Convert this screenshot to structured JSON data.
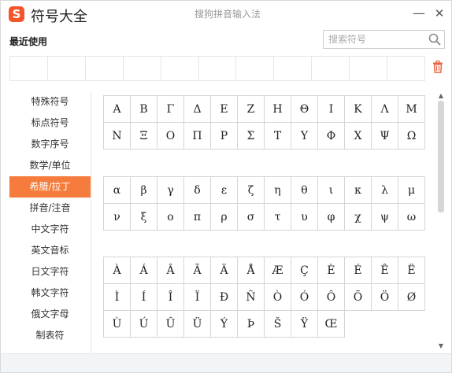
{
  "app": {
    "logo_letter": "S",
    "title": "符号大全",
    "ime_name": "搜狗拼音输入法",
    "minimize_glyph": "—",
    "close_glyph": "✕"
  },
  "recent": {
    "label": "最近使用",
    "slots": 11
  },
  "search": {
    "placeholder": "搜索符号",
    "value": ""
  },
  "sidebar": {
    "items": [
      {
        "label": "特殊符号",
        "active": false
      },
      {
        "label": "标点符号",
        "active": false
      },
      {
        "label": "数字序号",
        "active": false
      },
      {
        "label": "数学/单位",
        "active": false
      },
      {
        "label": "希腊/拉丁",
        "active": true
      },
      {
        "label": "拼音/注音",
        "active": false
      },
      {
        "label": "中文字符",
        "active": false
      },
      {
        "label": "英文音标",
        "active": false
      },
      {
        "label": "日文字符",
        "active": false
      },
      {
        "label": "韩文字符",
        "active": false
      },
      {
        "label": "俄文字母",
        "active": false
      },
      {
        "label": "制表符",
        "active": false
      }
    ]
  },
  "symbol_groups": [
    {
      "id": "greek-upper",
      "symbols": [
        "Α",
        "Β",
        "Γ",
        "Δ",
        "Ε",
        "Ζ",
        "Η",
        "Θ",
        "Ι",
        "Κ",
        "Λ",
        "Μ",
        "Ν",
        "Ξ",
        "Ο",
        "Π",
        "Ρ",
        "Σ",
        "Τ",
        "Υ",
        "Φ",
        "Χ",
        "Ψ",
        "Ω"
      ]
    },
    {
      "id": "greek-lower",
      "symbols": [
        "α",
        "β",
        "γ",
        "δ",
        "ε",
        "ζ",
        "η",
        "θ",
        "ι",
        "κ",
        "λ",
        "μ",
        "ν",
        "ξ",
        "ο",
        "π",
        "ρ",
        "σ",
        "τ",
        "υ",
        "φ",
        "χ",
        "ψ",
        "ω"
      ]
    },
    {
      "id": "latin-extended",
      "symbols": [
        "À",
        "Á",
        "Â",
        "Ã",
        "Ä",
        "Å",
        "Æ",
        "Ç",
        "È",
        "É",
        "Ê",
        "Ë",
        "Ì",
        "Í",
        "Î",
        "Ï",
        "Ð",
        "Ñ",
        "Ò",
        "Ó",
        "Ô",
        "Õ",
        "Ö",
        "Ø",
        "Ù",
        "Ú",
        "Û",
        "Ü",
        "Ý",
        "Þ",
        "Š",
        "Ÿ",
        "Œ"
      ]
    }
  ],
  "colors": {
    "brand": "#f5552a",
    "active_tab": "#f57c3c",
    "trash": "#e8603c"
  },
  "icons": {
    "search": "search-icon",
    "trash": "trash-icon",
    "minimize": "minimize-icon",
    "close": "close-icon"
  }
}
